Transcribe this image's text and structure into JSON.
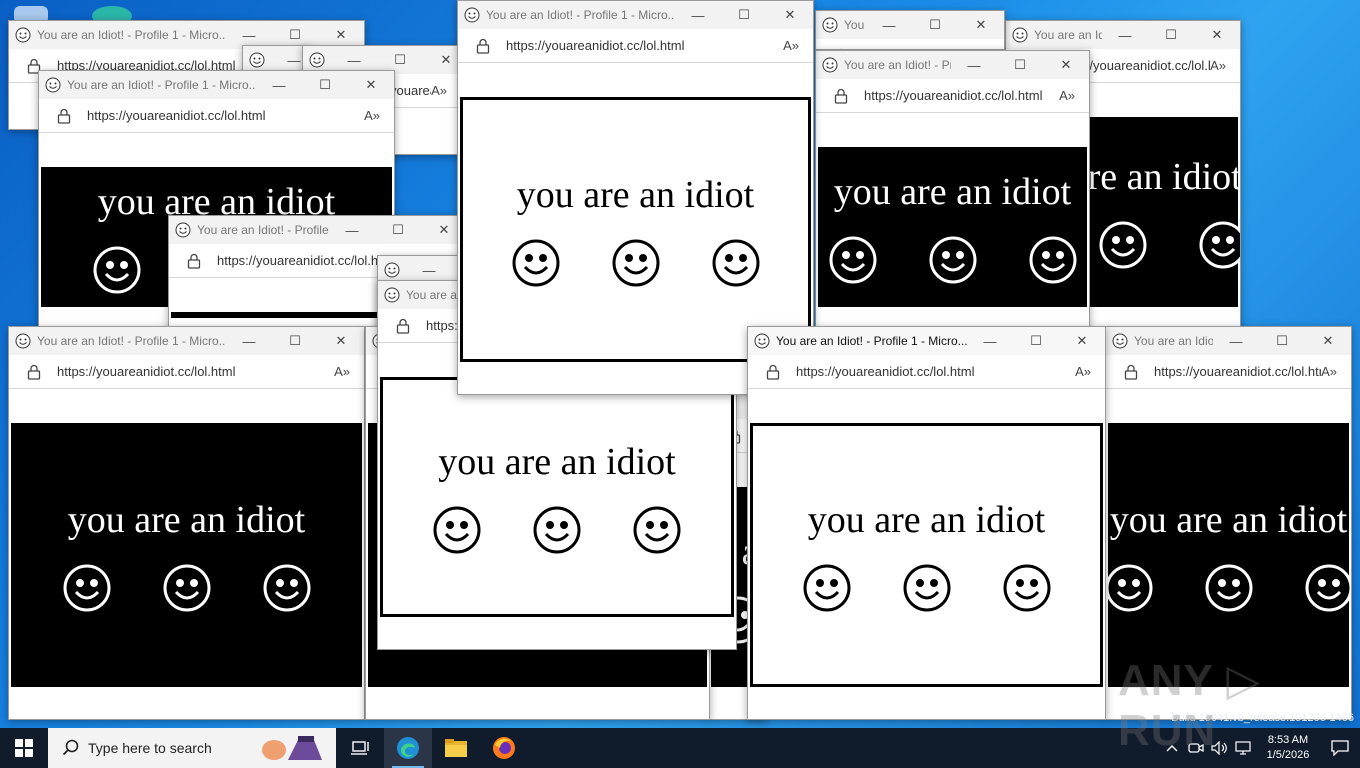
{
  "window_title": "You are an Idiot! - Profile 1 - Micro...",
  "window_title_short": "You are an Idiot! - Profile 1 - Micro...",
  "url": "https://youareanidiot.cc/lol.html",
  "message": "you are an idiot",
  "controls": {
    "minimize": "—",
    "maximize": "☐",
    "close": "✕",
    "read_aloud": "A»"
  },
  "taskbar": {
    "search_placeholder": "Type here to search",
    "time": "8:53 AM",
    "date": "1/5/2026"
  },
  "watermark": "ANY ▷ RUN",
  "build_text": "Build 19041.vb_release.191206-1406",
  "icons": [
    "windows-start-icon",
    "search-icon",
    "task-view-icon",
    "edge-icon",
    "file-explorer-icon",
    "firefox-icon",
    "chevron-up-icon",
    "meet-now-icon",
    "volume-icon",
    "network-icon",
    "notification-icon",
    "smiley-icon",
    "lock-icon"
  ],
  "colors": {
    "taskbar": "#101b2c",
    "desktop": "#1a8ce8",
    "accent": "#76b9ed"
  }
}
